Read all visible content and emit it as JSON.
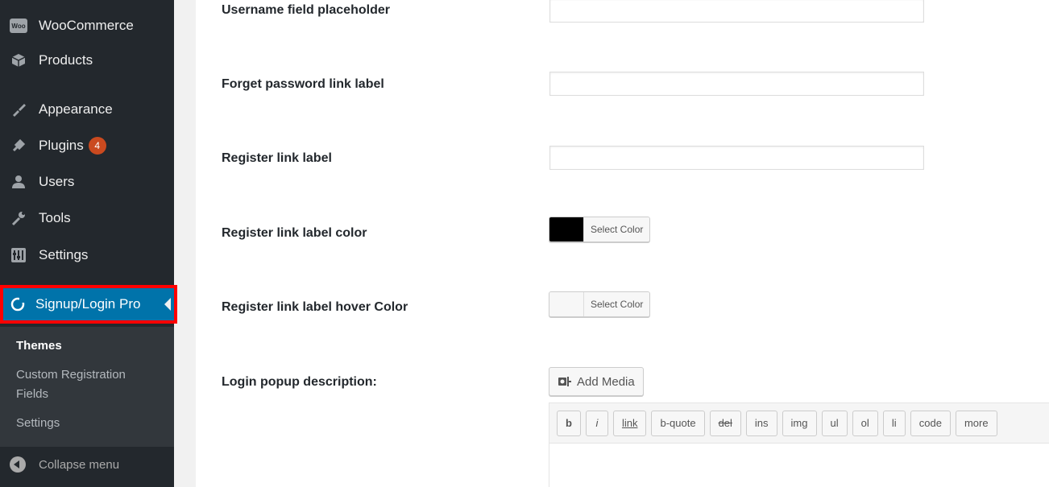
{
  "sidebar": {
    "items": [
      {
        "label": "WooCommerce",
        "icon": "woo-icon"
      },
      {
        "label": "Products",
        "icon": "box-icon"
      },
      {
        "label": "Appearance",
        "icon": "brush-icon"
      },
      {
        "label": "Plugins",
        "icon": "plugin-icon",
        "badge": "4"
      },
      {
        "label": "Users",
        "icon": "user-icon"
      },
      {
        "label": "Tools",
        "icon": "wrench-icon"
      },
      {
        "label": "Settings",
        "icon": "settings-icon"
      }
    ],
    "active": {
      "label": "Signup/Login Pro",
      "icon": "signup-icon"
    },
    "submenu": [
      {
        "label": "Themes",
        "current": true
      },
      {
        "label": "Custom Registration Fields",
        "current": false
      },
      {
        "label": "Settings",
        "current": false
      }
    ],
    "collapse_label": "Collapse menu",
    "woo_logo_text": "Woo"
  },
  "form": {
    "username_placeholder": {
      "label": "Username field placeholder",
      "value": ""
    },
    "forget_password": {
      "label": "Forget password link label",
      "value": ""
    },
    "register_link": {
      "label": "Register link label",
      "value": ""
    },
    "register_color": {
      "label": "Register link label color",
      "button": "Select Color",
      "color": "#000000"
    },
    "register_hover_color": {
      "label": "Register link label hover Color",
      "button": "Select Color",
      "color": "#f7f7f7"
    },
    "login_description": {
      "label": "Login popup description:"
    }
  },
  "editor": {
    "add_media": "Add Media",
    "quicktags": [
      "b",
      "i",
      "link",
      "b-quote",
      "del",
      "ins",
      "img",
      "ul",
      "ol",
      "li",
      "code",
      "more"
    ]
  }
}
